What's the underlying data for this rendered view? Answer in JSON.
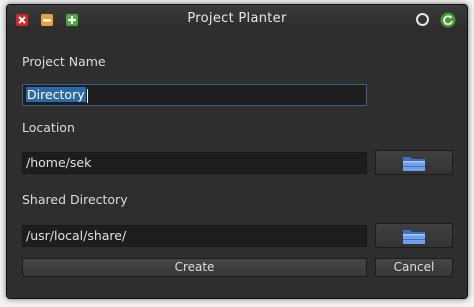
{
  "window": {
    "title": "Project Planter"
  },
  "form": {
    "project_name_label": "Project Name",
    "project_name_value": "Directory",
    "location_label": "Location",
    "location_value": "/home/sek",
    "shared_label": "Shared Directory",
    "shared_value": "/usr/local/share/"
  },
  "buttons": {
    "create": "Create",
    "cancel": "Cancel"
  },
  "icons": {
    "close": "close-icon",
    "minimize": "minimize-icon",
    "maximize": "maximize-icon",
    "circle": "circle-icon",
    "refresh": "refresh-icon",
    "folder": "folder-icon"
  },
  "colors": {
    "window_bg": "#2e2e2e",
    "field_bg": "#1e1e1e",
    "selection": "#2a6aa8"
  }
}
